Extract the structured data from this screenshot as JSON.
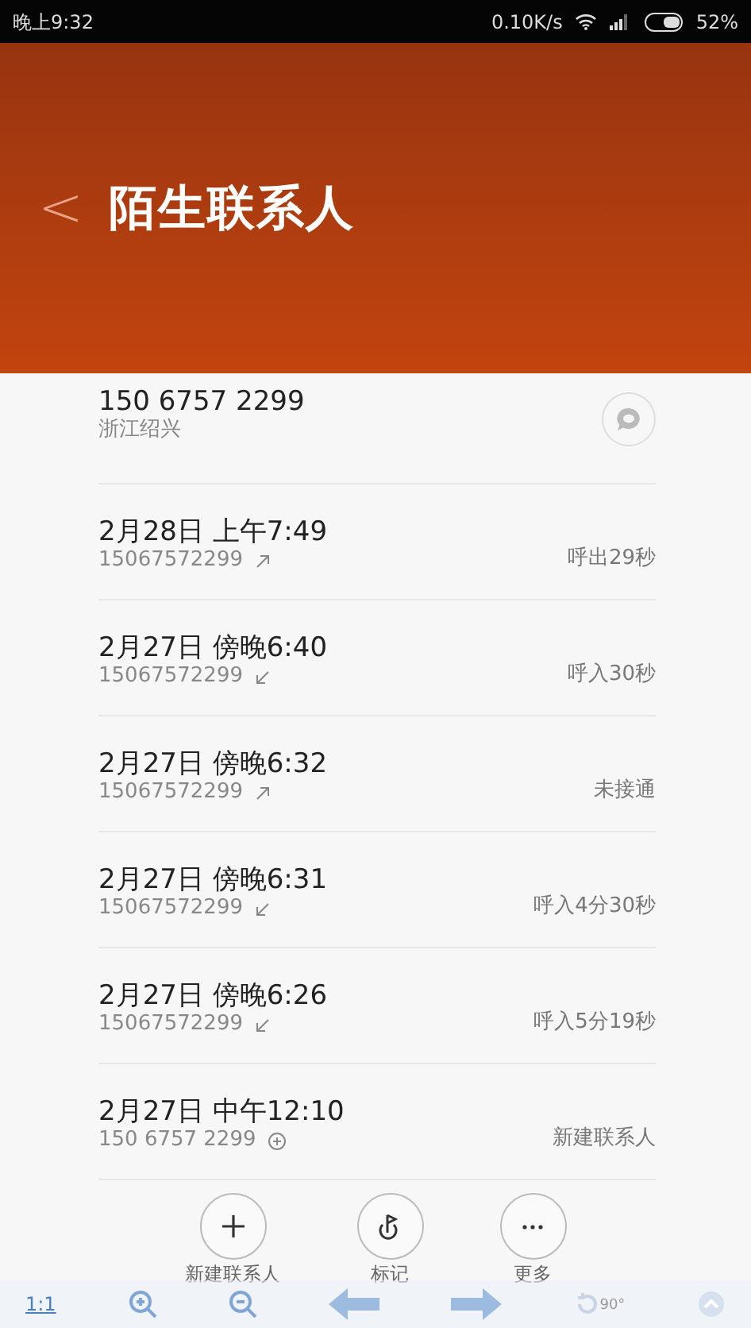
{
  "status_bar": {
    "time": "晚上9:32",
    "speed": "0.10K/s",
    "battery": "52%"
  },
  "header": {
    "back": "<",
    "title": "陌生联系人"
  },
  "contact": {
    "number": "150 6757 2299",
    "location": "浙江绍兴"
  },
  "calls": [
    {
      "datetime": "2月28日 上午7:49",
      "number": "15067572299",
      "kind": "out",
      "result": "呼出29秒"
    },
    {
      "datetime": "2月27日 傍晚6:40",
      "number": "15067572299",
      "kind": "in",
      "result": "呼入30秒"
    },
    {
      "datetime": "2月27日 傍晚6:32",
      "number": "15067572299",
      "kind": "out",
      "result": "未接通"
    },
    {
      "datetime": "2月27日 傍晚6:31",
      "number": "15067572299",
      "kind": "in",
      "result": "呼入4分30秒"
    },
    {
      "datetime": "2月27日 傍晚6:26",
      "number": "15067572299",
      "kind": "in",
      "result": "呼入5分19秒"
    },
    {
      "datetime": "2月27日 中午12:10",
      "number": "150 6757 2299",
      "kind": "add",
      "result": "新建联系人"
    }
  ],
  "actions": [
    {
      "kind": "add",
      "label": "新建联系人"
    },
    {
      "kind": "mark",
      "label": "标记"
    },
    {
      "kind": "more",
      "label": "更多"
    }
  ],
  "viewer_toolbar": {
    "zoom_label": "1:1",
    "rotate_label": "90°"
  }
}
